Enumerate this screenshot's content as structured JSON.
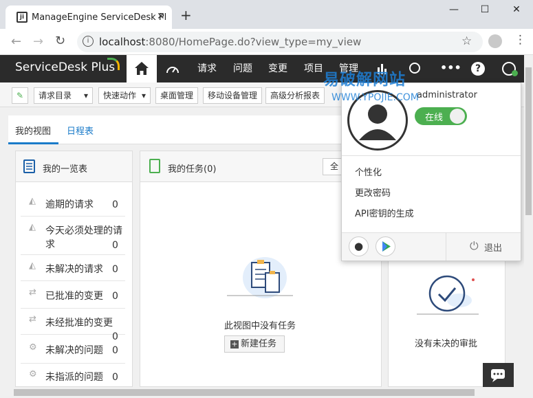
{
  "browser": {
    "tab_title": "ManageEngine ServiceDesk Pl",
    "favicon_text": "ji",
    "url_host": "localhost",
    "url_path": ":8080/HomePage.do?view_type=my_view"
  },
  "app": {
    "logo": "ServiceDesk Plus",
    "nav": [
      "请求",
      "问题",
      "变更",
      "项目",
      "管理"
    ],
    "toolbar": [
      "请求目录",
      "快速动作",
      "桌面管理",
      "移动设备管理",
      "高级分析报表"
    ]
  },
  "view_tabs": [
    "我的视图",
    "日程表"
  ],
  "summary": {
    "title": "我的一览表",
    "rows": [
      {
        "label": "逾期的请求",
        "count": "0"
      },
      {
        "label": "今天必须处理的请求",
        "count": "0"
      },
      {
        "label": "未解决的请求",
        "count": "0"
      },
      {
        "label": "已批准的变更",
        "count": "0"
      },
      {
        "label": "未经批准的变更",
        "count": "0"
      },
      {
        "label": "未解决的问题",
        "count": "0"
      },
      {
        "label": "未指派的问题",
        "count": "0"
      }
    ],
    "extra_count": "0"
  },
  "tasks": {
    "title": "我的任务(0)",
    "filter_label": "全",
    "empty_text": "此视图中没有任务",
    "new_task_label": "新建任务"
  },
  "approvals": {
    "empty_text": "没有未决的审批"
  },
  "profile_popup": {
    "username": "administrator",
    "status_label": "在线",
    "menu": [
      "个性化",
      "更改密码",
      "API密钥的生成"
    ],
    "logout_label": "退出"
  },
  "watermark": {
    "main": "易破解网站",
    "sub": "WWW.YPOJIE.COM"
  },
  "colors": {
    "header_bg": "#2b2b2b",
    "accent_blue": "#1a7bc9",
    "online_green": "#4caf50"
  }
}
